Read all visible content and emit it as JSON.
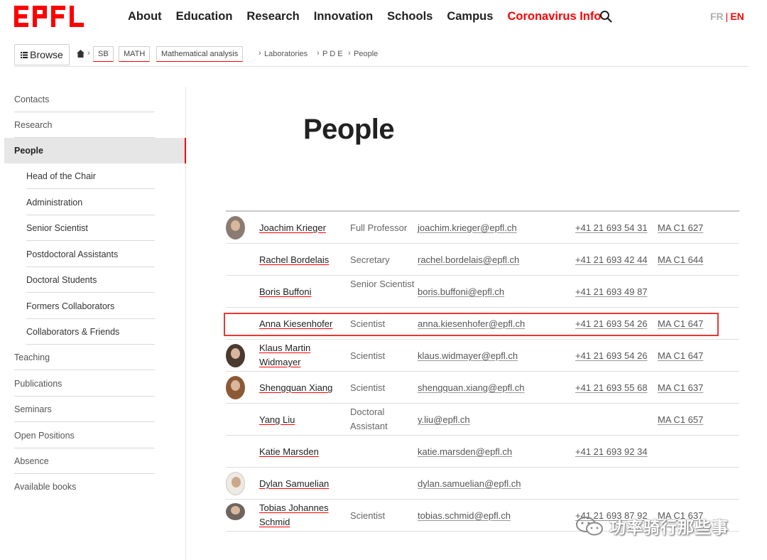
{
  "header": {
    "logo": "EPFL",
    "nav": [
      "About",
      "Education",
      "Research",
      "Innovation",
      "Schools",
      "Campus",
      "Coronavirus Info"
    ],
    "lang_fr": "FR",
    "lang_sep": "|",
    "lang_en": "EN"
  },
  "breadcrumb": {
    "browse_label": "Browse",
    "tags": [
      "SB",
      "MATH",
      "Mathematical analysis"
    ],
    "trail": [
      "Laboratories",
      "P D E",
      "People"
    ]
  },
  "sidebar": {
    "items": [
      "Contacts",
      "Research",
      "People",
      "Head of the Chair",
      "Administration",
      "Senior Scientist",
      "Postdoctoral Assistants",
      "Doctoral Students",
      "Formers Collaborators",
      "Collaborators & Friends",
      "Teaching",
      "Publications",
      "Seminars",
      "Open Positions",
      "Absence",
      "Available books"
    ]
  },
  "main": {
    "title": "People",
    "people": [
      {
        "name": "Joachim Krieger",
        "title": "Full Professor",
        "email": "joachim.krieger@epfl.ch",
        "phone": "+41 21 693 54 31",
        "room": "MA C1 627"
      },
      {
        "name": "Rachel Bordelais",
        "title": "Secretary",
        "email": "rachel.bordelais@epfl.ch",
        "phone": "+41 21 693 42 44",
        "room": "MA C1 644"
      },
      {
        "name": "Boris Buffoni",
        "title": "Senior Scientist",
        "email": "boris.buffoni@epfl.ch",
        "phone": "+41 21 693 49 87",
        "room": ""
      },
      {
        "name": "Anna Kiesenhofer",
        "title": "Scientist",
        "email": "anna.kiesenhofer@epfl.ch",
        "phone": "+41 21 693 54 26",
        "room": "MA C1 647"
      },
      {
        "name": "Klaus Martin Widmayer",
        "title": "Scientist",
        "email": "klaus.widmayer@epfl.ch",
        "phone": "+41 21 693 54 26",
        "room": "MA C1 647"
      },
      {
        "name": "Shengquan Xiang",
        "title": "Scientist",
        "email": "shengquan.xiang@epfl.ch",
        "phone": "+41 21 693 55 68",
        "room": "MA C1 637"
      },
      {
        "name": "Yang Liu",
        "title": "Doctoral Assistant",
        "email": "y.liu@epfl.ch",
        "phone": "",
        "room": "MA C1 657"
      },
      {
        "name": "Katie Marsden",
        "title": "",
        "email": "katie.marsden@epfl.ch",
        "phone": "+41 21 693 92 34",
        "room": ""
      },
      {
        "name": "Dylan Samuelian",
        "title": "",
        "email": "dylan.samuelian@epfl.ch",
        "phone": "",
        "room": ""
      },
      {
        "name": "Tobias Johannes Schmid",
        "title": "Scientist",
        "email": "tobias.schmid@epfl.ch",
        "phone": "+41 21 693 87 92",
        "room": "MA C1 637"
      }
    ]
  },
  "watermark": {
    "text": "功率骑行那些事"
  },
  "colors": {
    "accent": "#ff0000",
    "highlight_box": "#e53935",
    "active_bg": "#e6e6e6"
  }
}
